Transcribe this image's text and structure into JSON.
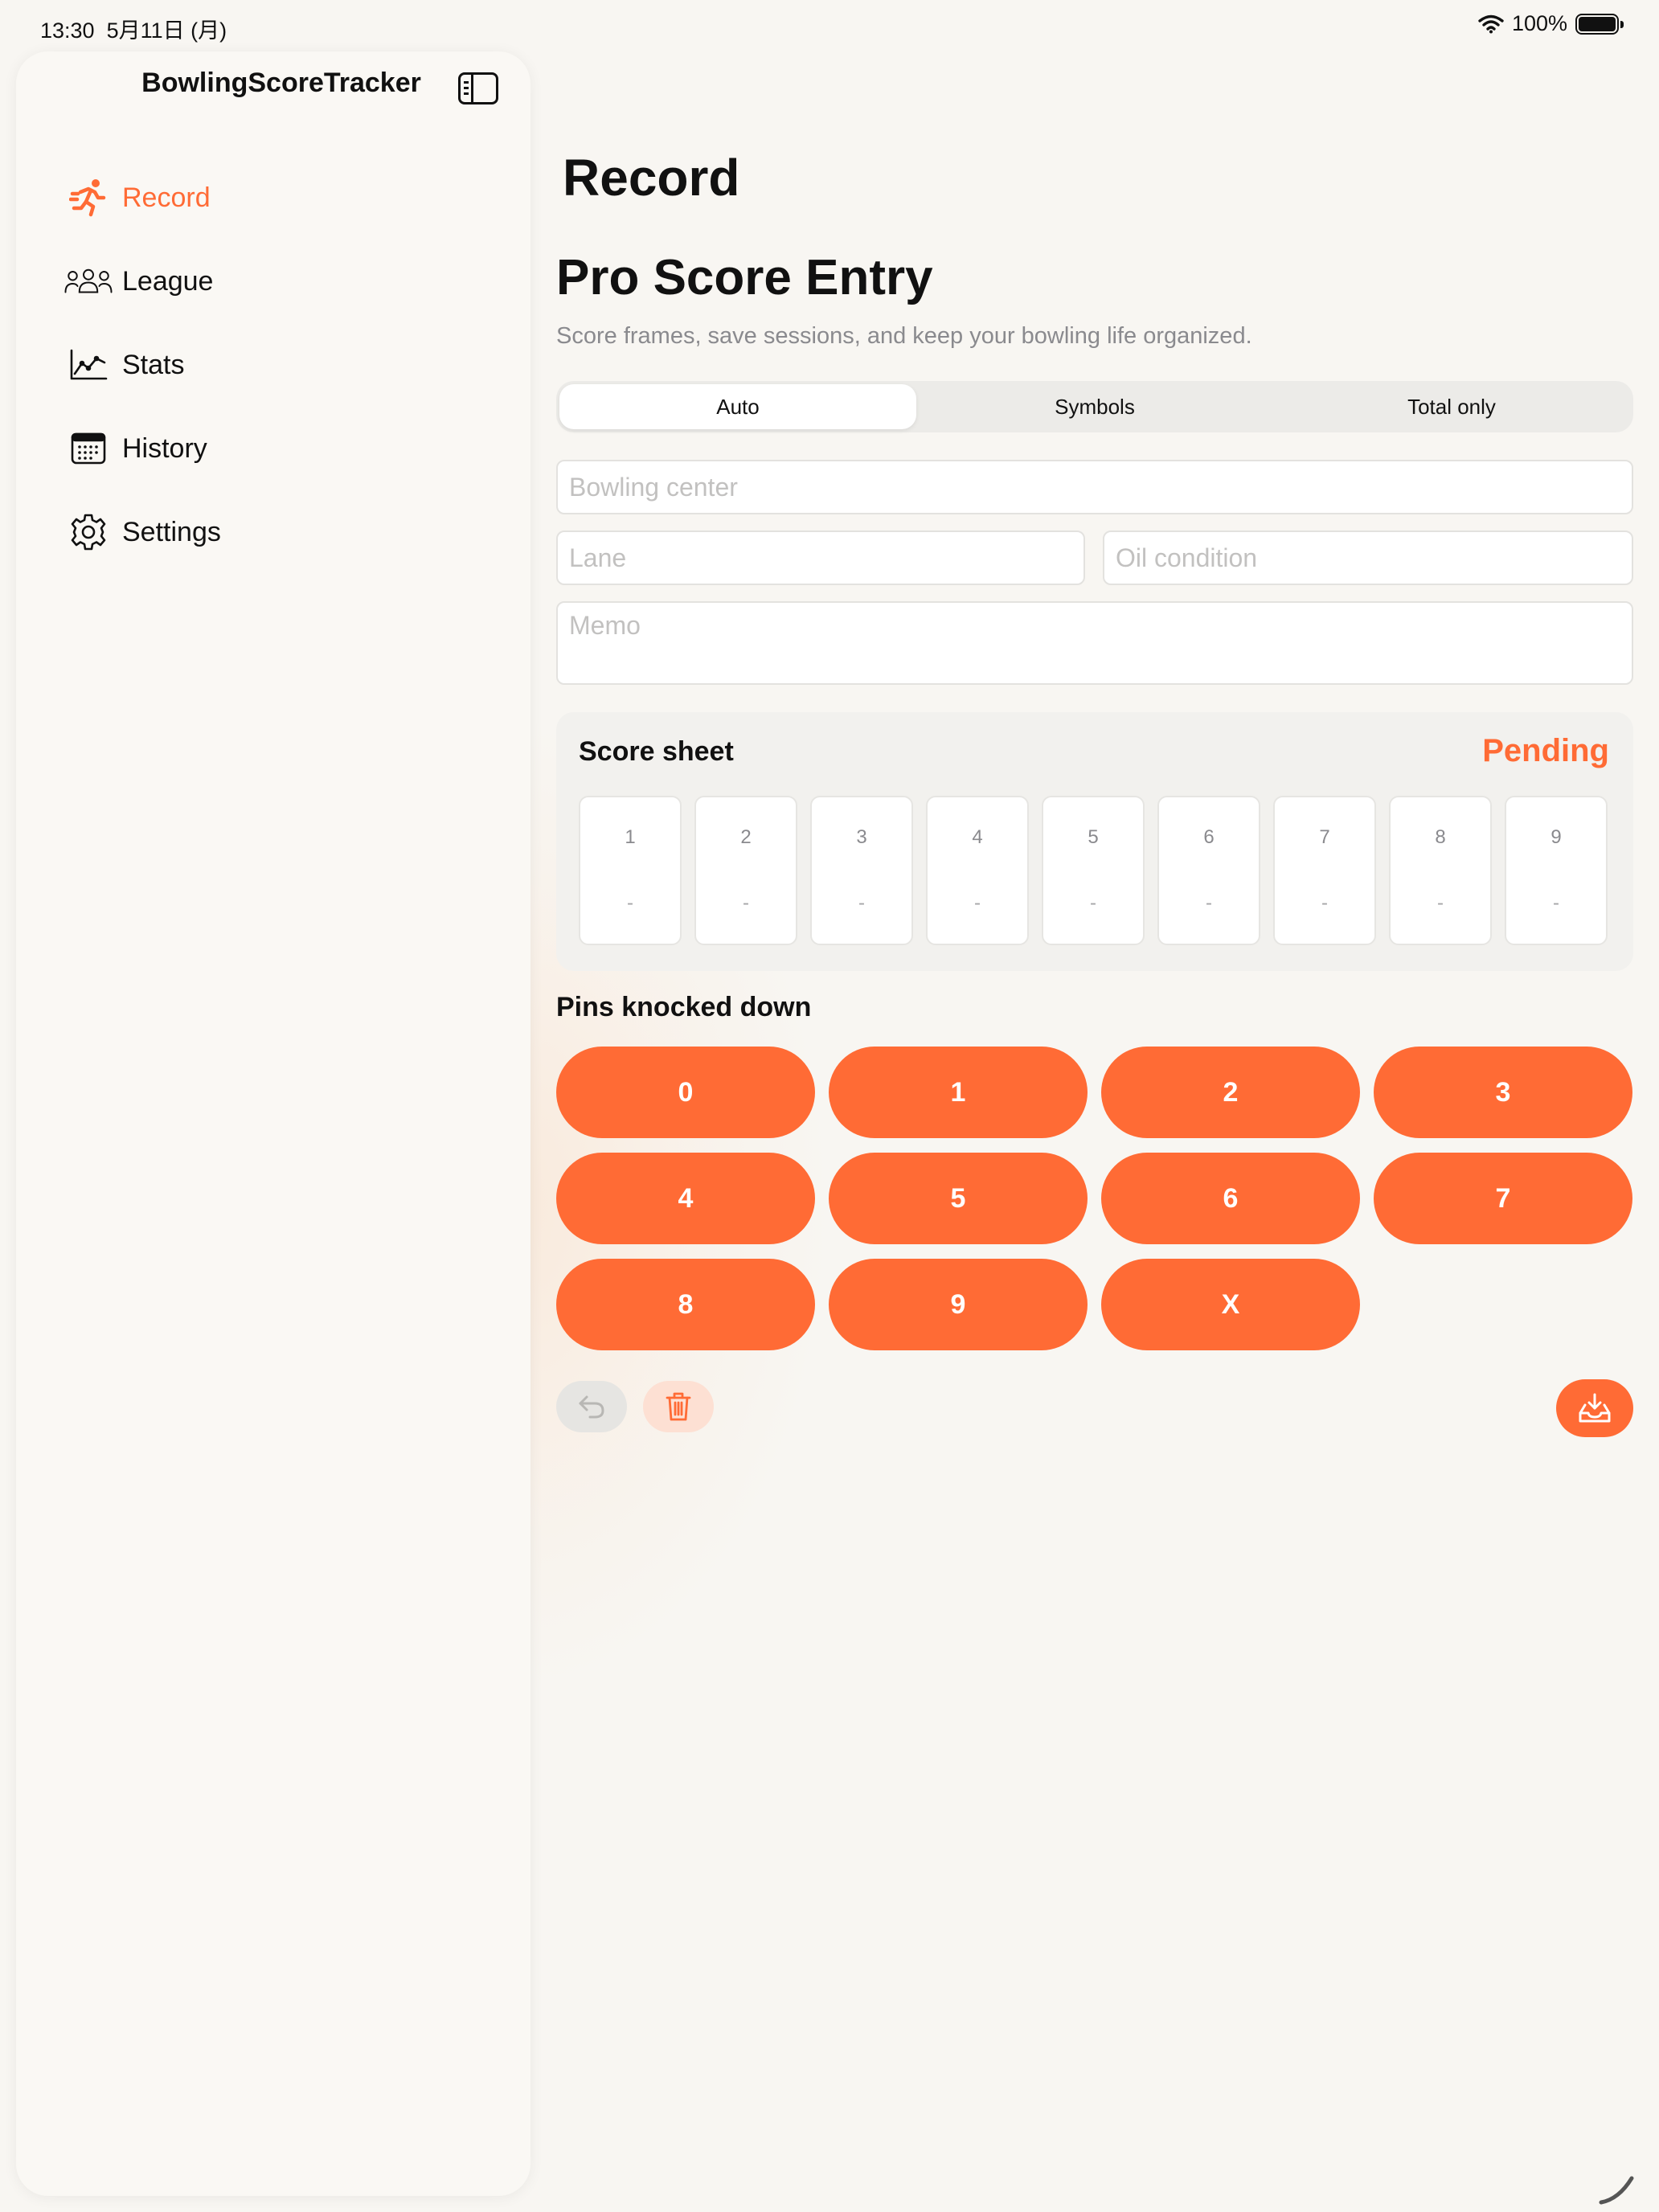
{
  "status_bar": {
    "time": "13:30",
    "date": "5月11日 (月)",
    "battery": "100%"
  },
  "sidebar": {
    "title": "BowlingScoreTracker",
    "items": [
      {
        "label": "Record",
        "icon": "runner-icon",
        "active": true
      },
      {
        "label": "League",
        "icon": "people-icon",
        "active": false
      },
      {
        "label": "Stats",
        "icon": "chart-icon",
        "active": false
      },
      {
        "label": "History",
        "icon": "calendar-icon",
        "active": false
      },
      {
        "label": "Settings",
        "icon": "gear-icon",
        "active": false
      }
    ]
  },
  "main": {
    "nav_title": "Record",
    "heading": "Pro Score Entry",
    "subtitle": "Score frames, save sessions, and keep your bowling life organized.",
    "mode_tabs": [
      {
        "label": "Auto",
        "selected": true
      },
      {
        "label": "Symbols",
        "selected": false
      },
      {
        "label": "Total only",
        "selected": false
      }
    ],
    "fields": {
      "center": {
        "placeholder": "Bowling center",
        "value": ""
      },
      "lane": {
        "placeholder": "Lane",
        "value": ""
      },
      "oil": {
        "placeholder": "Oil condition",
        "value": ""
      },
      "memo": {
        "placeholder": "Memo",
        "value": ""
      }
    },
    "score_sheet": {
      "title": "Score sheet",
      "status": "Pending",
      "frames": [
        {
          "num": "1",
          "score": "-"
        },
        {
          "num": "2",
          "score": "-"
        },
        {
          "num": "3",
          "score": "-"
        },
        {
          "num": "4",
          "score": "-"
        },
        {
          "num": "5",
          "score": "-"
        },
        {
          "num": "6",
          "score": "-"
        },
        {
          "num": "7",
          "score": "-"
        },
        {
          "num": "8",
          "score": "-"
        },
        {
          "num": "9",
          "score": "-"
        }
      ]
    },
    "pins": {
      "title": "Pins knocked down",
      "buttons": [
        "0",
        "1",
        "2",
        "3",
        "4",
        "5",
        "6",
        "7",
        "8",
        "9",
        "X"
      ]
    }
  },
  "colors": {
    "accent": "#ff6b35",
    "background": "#f8f6f2",
    "undo_bg": "#e6e5e2",
    "delete_bg": "#fde0d3"
  }
}
